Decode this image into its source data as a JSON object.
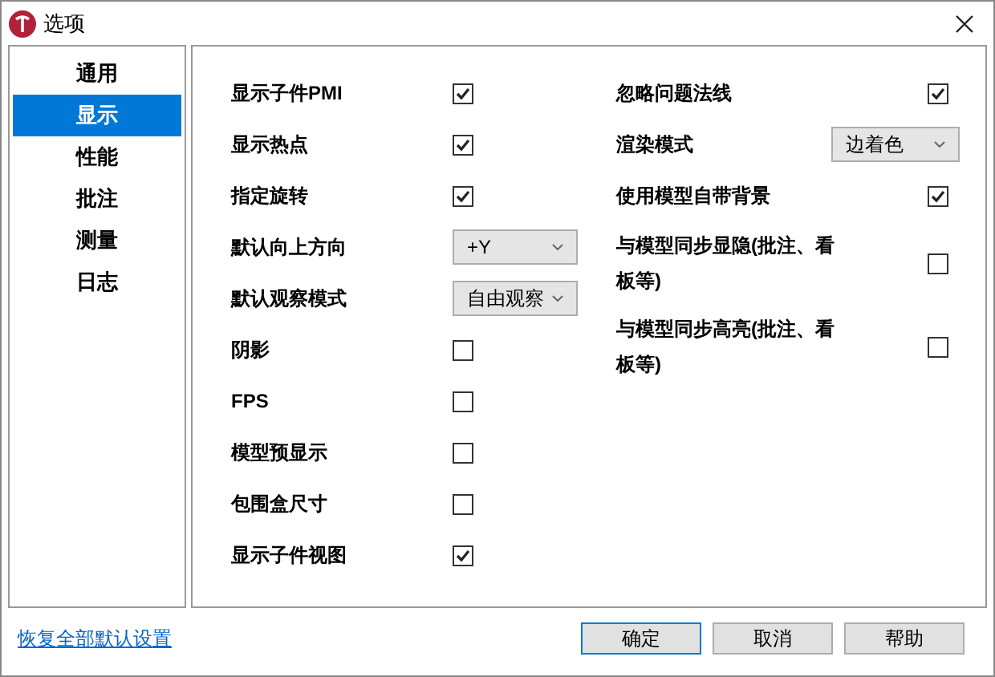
{
  "window": {
    "title": "选项"
  },
  "sidebar": {
    "items": [
      {
        "label": "通用",
        "selected": false
      },
      {
        "label": "显示",
        "selected": true
      },
      {
        "label": "性能",
        "selected": false
      },
      {
        "label": "批注",
        "selected": false
      },
      {
        "label": "测量",
        "selected": false
      },
      {
        "label": "日志",
        "selected": false
      }
    ]
  },
  "left_options": [
    {
      "kind": "checkbox",
      "label": "显示子件PMI",
      "checked": true
    },
    {
      "kind": "checkbox",
      "label": "显示热点",
      "checked": true
    },
    {
      "kind": "checkbox",
      "label": "指定旋转",
      "checked": true
    },
    {
      "kind": "select",
      "label": "默认向上方向",
      "value": "+Y"
    },
    {
      "kind": "select",
      "label": "默认观察模式",
      "value": "自由观察"
    },
    {
      "kind": "checkbox",
      "label": "阴影",
      "checked": false
    },
    {
      "kind": "checkbox",
      "label": "FPS",
      "checked": false
    },
    {
      "kind": "checkbox",
      "label": "模型预显示",
      "checked": false
    },
    {
      "kind": "checkbox",
      "label": "包围盒尺寸",
      "checked": false
    },
    {
      "kind": "checkbox",
      "label": "显示子件视图",
      "checked": true
    }
  ],
  "right_options": [
    {
      "kind": "checkbox",
      "label": "忽略问题法线",
      "checked": true
    },
    {
      "kind": "select",
      "label": "渲染模式",
      "value": "边着色"
    },
    {
      "kind": "checkbox",
      "label": "使用模型自带背景",
      "checked": true
    },
    {
      "kind": "checkbox",
      "label": "与模型同步显隐(批注、看板等)",
      "checked": false
    },
    {
      "kind": "checkbox",
      "label": "与模型同步高亮(批注、看板等)",
      "checked": false
    }
  ],
  "footer": {
    "link": "恢复全部默认设置",
    "buttons": [
      {
        "label": "确定",
        "default": true
      },
      {
        "label": "取消",
        "default": false
      },
      {
        "label": "帮助",
        "default": false
      }
    ]
  }
}
